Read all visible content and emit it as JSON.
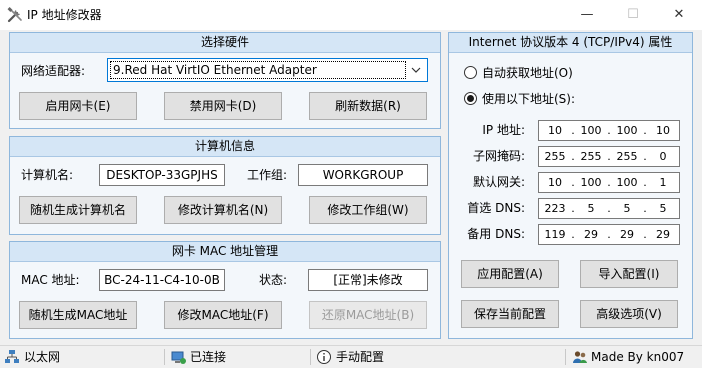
{
  "window": {
    "title": "IP 地址修改器",
    "minimize_glyph": "—",
    "maximize_glyph": "☐",
    "close_glyph": "✕",
    "icon": "tools-icon"
  },
  "hardware": {
    "header": "选择硬件",
    "adapter_label": "网络适配器:",
    "adapter_value": "9.Red Hat VirtIO Ethernet Adapter",
    "enable_button": "启用网卡(E)",
    "disable_button": "禁用网卡(D)",
    "refresh_button": "刷新数据(R)"
  },
  "computer": {
    "header": "计算机信息",
    "name_label": "计算机名:",
    "name_value": "DESKTOP-33GPJHS",
    "workgroup_label": "工作组:",
    "workgroup_value": "WORKGROUP",
    "random_name_button": "随机生成计算机名",
    "modify_name_button": "修改计算机名(N)",
    "modify_workgroup_button": "修改工作组(W)"
  },
  "mac": {
    "header": "网卡 MAC 地址管理",
    "mac_label": "MAC 地址:",
    "mac_value": "BC-24-11-C4-10-0B",
    "status_label": "状态:",
    "status_value": "[正常]未修改",
    "random_mac_button": "随机生成MAC地址",
    "modify_mac_button": "修改MAC地址(F)",
    "restore_mac_button": "还原MAC地址(B)"
  },
  "ipv4": {
    "header": "Internet 协议版本 4 (TCP/IPv4) 属性",
    "auto_radio": "自动获取地址(O)",
    "manual_radio": "使用以下地址(S):",
    "selected_mode": "manual",
    "fields": [
      {
        "label": "IP 地址:",
        "octets": [
          "10",
          "100",
          "100",
          "10"
        ]
      },
      {
        "label": "子网掩码:",
        "octets": [
          "255",
          "255",
          "255",
          "0"
        ]
      },
      {
        "label": "默认网关:",
        "octets": [
          "10",
          "100",
          "100",
          "1"
        ]
      },
      {
        "label": "首选 DNS:",
        "octets": [
          "223",
          "5",
          "5",
          "5"
        ]
      },
      {
        "label": "备用 DNS:",
        "octets": [
          "119",
          "29",
          "29",
          "29"
        ]
      }
    ],
    "apply_button": "应用配置(A)",
    "import_button": "导入配置(I)",
    "save_button": "保存当前配置",
    "advanced_button": "高级选项(V)"
  },
  "statusbar": {
    "network_type": "以太网",
    "connection": "已连接",
    "config_mode": "手动配置",
    "author": "Made By kn007"
  },
  "colors": {
    "group_border": "#8fb7dc",
    "group_header_bg": "#d5e6f6",
    "select_focus": "#0078d7"
  }
}
